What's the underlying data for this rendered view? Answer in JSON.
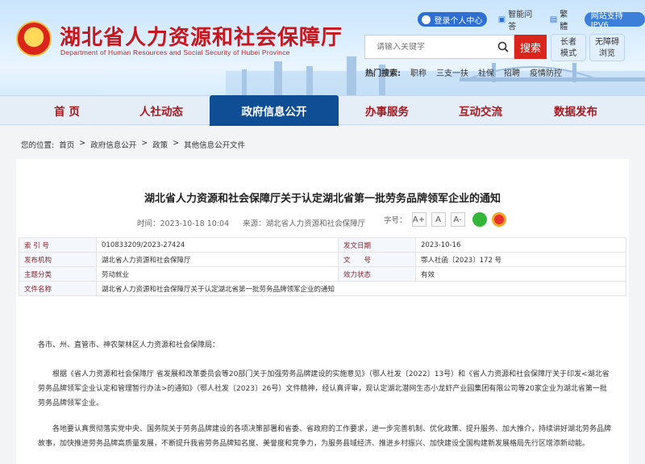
{
  "header": {
    "title": "湖北省人力资源和社会保障厅",
    "subtitle": "Department of Human Resources and Social Security of Hubei Province",
    "login_label": "登录个人中心",
    "qa_label": "智能问答",
    "simple_label": "繁體",
    "ipv6_label": "网站支持IPV6",
    "search_placeholder": "请输入关键字",
    "search_button": "搜索",
    "elder_label_1": "长者",
    "elder_label_2": "模式",
    "access_label_1": "无障碍",
    "access_label_2": "浏览",
    "hot_label": "热门搜索:",
    "hot_items": [
      "职称",
      "三支一扶",
      "社保",
      "招聘",
      "疫情防控"
    ]
  },
  "nav": [
    "首 页",
    "人社动态",
    "政府信息公开",
    "办事服务",
    "互动交流",
    "数据发布"
  ],
  "breadcrumb": {
    "label": "您的位置:",
    "items": [
      "首页",
      "政府信息公开",
      "政策",
      "其他信息公开文件"
    ],
    "sep": ">"
  },
  "article": {
    "title": "湖北省人力资源和社会保障厅关于认定湖北省第一批劳务品牌领军企业的通知",
    "time": "时间：2023-10-18 10:04",
    "source": "来源：湖北省人力资源和社会保障厅",
    "font_label": "字号：",
    "fs": [
      "A+",
      "A",
      "A-"
    ],
    "info": {
      "index_k": "索 引 号",
      "index_v": "010833209/2023-27424",
      "date_k": "发文日期",
      "date_v": "2023-10-16",
      "org_k": "发布机构",
      "org_v": "湖北省人力资源和社会保障厅",
      "num_k": "文　　号",
      "num_v": "鄂人社函〔2023〕172 号",
      "cat_k": "主题分类",
      "cat_v": "劳动就业",
      "status_k": "效力状态",
      "status_v": "有效",
      "name_k": "文件名称",
      "name_v": "湖北省人力资源和社会保障厅关于认定湖北省第一批劳务品牌领军企业的通知"
    },
    "p1": "各市、州、直管市、神农架林区人力资源和社会保障局：",
    "p2": "根据《省人力资源和社会保障厅 省发展和改革委员会等20部门关于加强劳务品牌建设的实施意见》（鄂人社发〔2022〕13号）和《省人力资源和社会保障厅关于印发<湖北省劳务品牌领军企业认定和管理暂行办法>的通知》（鄂人社发〔2023〕26号）文件精神，经认真评审，现认定湖北潜网生态小龙虾产业园集团有限公司等20家企业为湖北省第一批劳务品牌领军企业。",
    "p3": "各地要认真贯彻落实党中央、国务院关于劳务品牌建设的各项决策部署和省委、省政府的工作要求，进一步完善机制、优化政策、提升服务、加大推介，持续讲好湖北劳务品牌故事，加快推进劳务品牌高质量发展，不断提升我省劳务品牌知名度、美誉度和竞争力，为服务县域经济、推进乡村振兴、加快建设全国构建新发展格局先行区增添新动能。"
  }
}
